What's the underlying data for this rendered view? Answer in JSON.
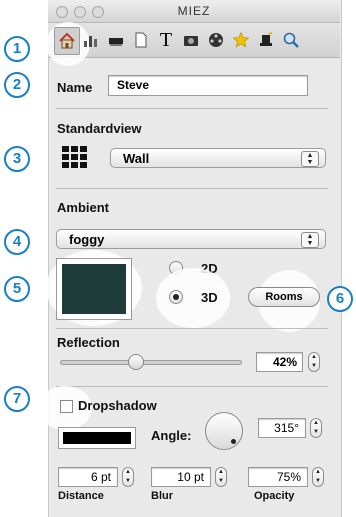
{
  "window": {
    "title": "MIEZ"
  },
  "toolbar": {
    "icons": [
      "home-icon",
      "chart-icon",
      "layers-icon",
      "page-icon",
      "text-icon",
      "photo-icon",
      "film-icon",
      "star-icon",
      "magic-hat-icon",
      "magnifier-icon"
    ],
    "selected_index": 0,
    "text_glyph": "T"
  },
  "callouts": [
    "1",
    "2",
    "3",
    "4",
    "5",
    "6",
    "7"
  ],
  "name": {
    "label": "Name",
    "value": "Steve"
  },
  "standardview": {
    "label": "Standardview",
    "selected": "Wall"
  },
  "ambient": {
    "label": "Ambient",
    "selected": "foggy",
    "swatch_color": "#1e3d3a",
    "mode_options": [
      "2D",
      "3D"
    ],
    "mode_selected": "3D",
    "rooms_button": "Rooms"
  },
  "reflection": {
    "label": "Reflection",
    "value": "42%",
    "level": 0.42
  },
  "dropshadow": {
    "label": "Dropshadow",
    "checked": false,
    "color": "#000000",
    "angle_label": "Angle:",
    "angle_value": "315°",
    "distance_value": "6 pt",
    "distance_label": "Distance",
    "blur_value": "10 pt",
    "blur_label": "Blur",
    "opacity_value": "75%",
    "opacity_label": "Opacity"
  }
}
